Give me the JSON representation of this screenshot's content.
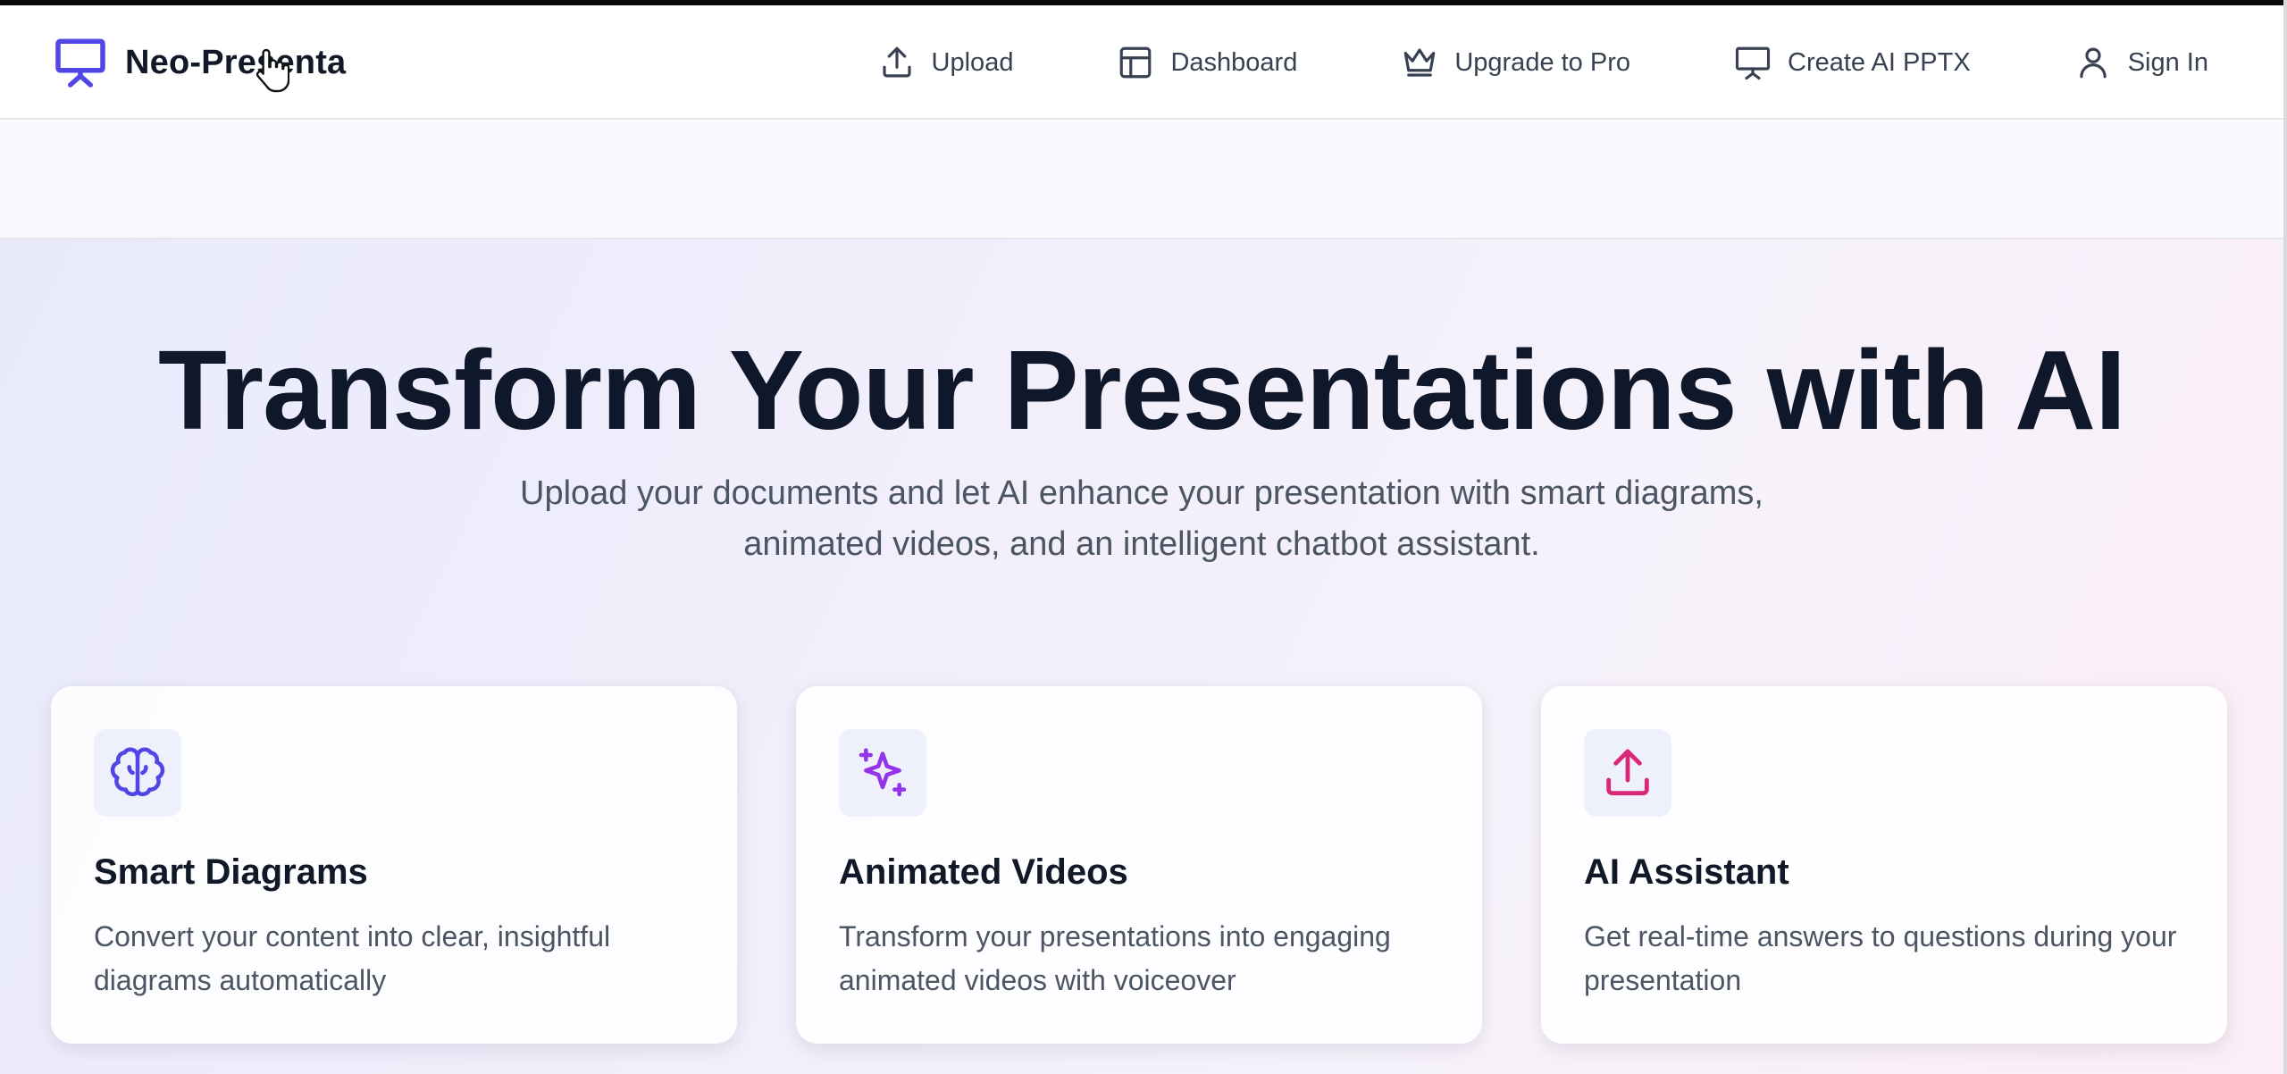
{
  "brand": {
    "name": "Neo-Presenta",
    "logo_icon": "presentation-board-icon",
    "color": "#4f46e5"
  },
  "nav": {
    "items": [
      {
        "label": "Upload",
        "icon": "upload-icon"
      },
      {
        "label": "Dashboard",
        "icon": "layout-icon"
      },
      {
        "label": "Upgrade to Pro",
        "icon": "crown-icon"
      },
      {
        "label": "Create AI PPTX",
        "icon": "presentation-icon"
      },
      {
        "label": "Sign In",
        "icon": "user-icon"
      }
    ]
  },
  "hero": {
    "title": "Transform Your Presentations with AI",
    "subtitle": "Upload your documents and let AI enhance your presentation with smart diagrams, animated videos, and an intelligent chatbot assistant."
  },
  "features": [
    {
      "title": "Smart Diagrams",
      "description": "Convert your content into clear, insightful diagrams automatically",
      "icon": "brain-icon",
      "color": "#4f46e5"
    },
    {
      "title": "Animated Videos",
      "description": "Transform your presentations into engaging animated videos with voiceover",
      "icon": "sparkles-icon",
      "color": "#9333ea"
    },
    {
      "title": "AI Assistant",
      "description": "Get real-time answers to questions during your presentation",
      "icon": "upload-icon",
      "color": "#db2777"
    }
  ]
}
